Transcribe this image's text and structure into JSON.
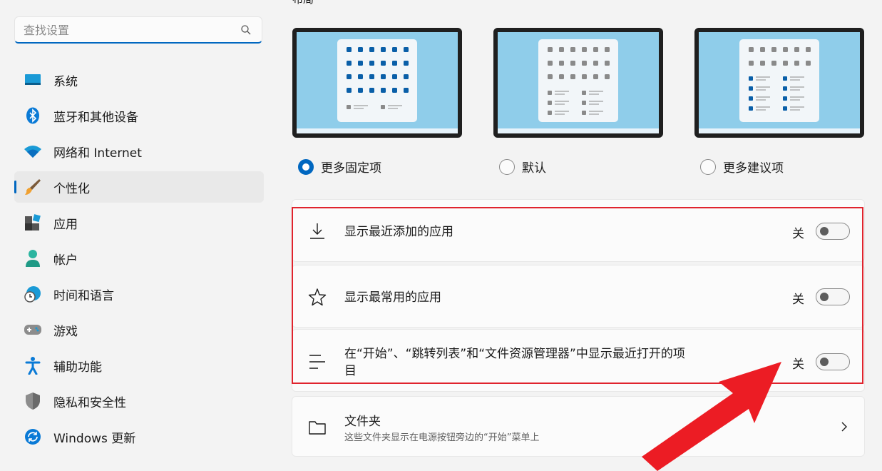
{
  "search": {
    "placeholder": "查找设置",
    "icon": "search-icon"
  },
  "sidebar": {
    "items": [
      {
        "label": "系统",
        "icon": "display-icon",
        "active": false
      },
      {
        "label": "蓝牙和其他设备",
        "icon": "bluetooth-icon",
        "active": false
      },
      {
        "label": "网络和 Internet",
        "icon": "wifi-icon",
        "active": false
      },
      {
        "label": "个性化",
        "icon": "paintbrush-icon",
        "active": true
      },
      {
        "label": "应用",
        "icon": "apps-icon",
        "active": false
      },
      {
        "label": "帐户",
        "icon": "person-icon",
        "active": false
      },
      {
        "label": "时间和语言",
        "icon": "globe-clock-icon",
        "active": false
      },
      {
        "label": "游戏",
        "icon": "gamepad-icon",
        "active": false
      },
      {
        "label": "辅助功能",
        "icon": "accessibility-icon",
        "active": false
      },
      {
        "label": "隐私和安全性",
        "icon": "shield-icon",
        "active": false
      },
      {
        "label": "Windows 更新",
        "icon": "sync-icon",
        "active": false
      }
    ]
  },
  "layout": {
    "heading": "布局",
    "options": [
      {
        "label": "更多固定项",
        "checked": true
      },
      {
        "label": "默认",
        "checked": false
      },
      {
        "label": "更多建议项",
        "checked": false
      }
    ]
  },
  "settings": [
    {
      "label": "显示最近添加的应用",
      "state": "关",
      "on": false,
      "icon": "download-icon"
    },
    {
      "label": "显示最常用的应用",
      "state": "关",
      "on": false,
      "icon": "star-icon"
    },
    {
      "label": "在“开始”、“跳转列表”和“文件资源管理器”中显示最近打开的项目",
      "state": "关",
      "on": false,
      "icon": "list-icon"
    }
  ],
  "folders": {
    "title": "文件夹",
    "subtitle": "这些文件夹显示在电源按钮旁边的“开始”菜单上",
    "icon": "folder-icon"
  },
  "colors": {
    "accent": "#0067c0",
    "highlight": "#e0232d",
    "preview_bg": "#8fcdea"
  }
}
